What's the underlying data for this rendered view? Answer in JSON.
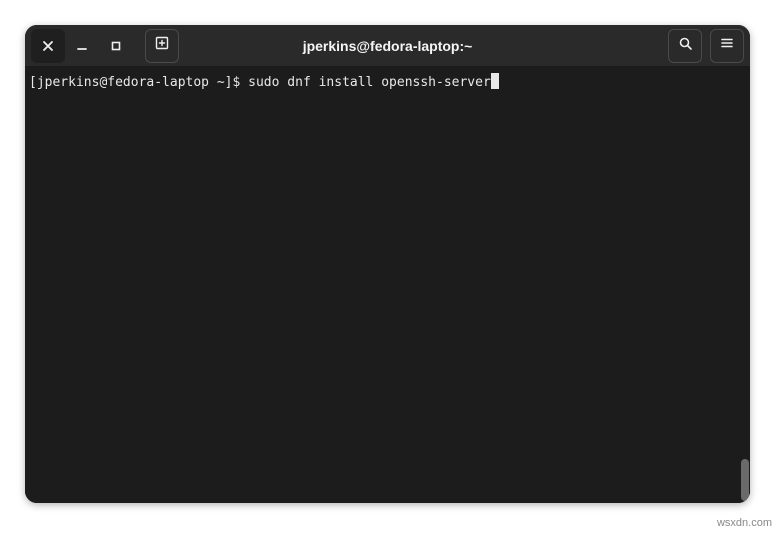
{
  "window": {
    "title": "jperkins@fedora-laptop:~"
  },
  "terminal": {
    "prompt": "[jperkins@fedora-laptop ~]$ ",
    "command": "sudo dnf install openssh-server"
  },
  "watermark": "wsxdn.com"
}
